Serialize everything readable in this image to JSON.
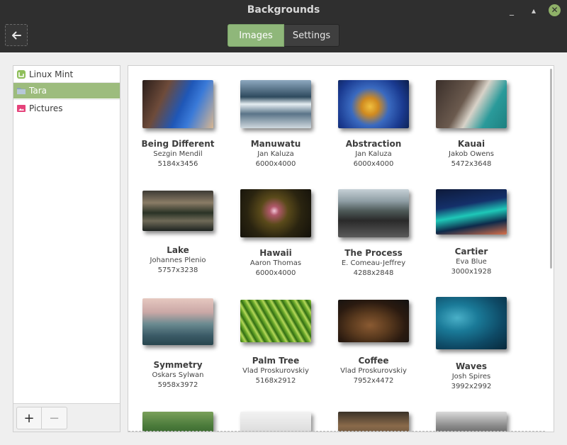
{
  "window": {
    "title": "Backgrounds"
  },
  "header": {
    "tabs": [
      {
        "label": "Images",
        "active": true
      },
      {
        "label": "Settings",
        "active": false
      }
    ]
  },
  "sidebar": {
    "items": [
      {
        "label": "Linux Mint",
        "selected": false,
        "icon": "mint-logo-icon"
      },
      {
        "label": "Tara",
        "selected": true,
        "icon": "folder-icon"
      },
      {
        "label": "Pictures",
        "selected": false,
        "icon": "pictures-folder-icon"
      }
    ],
    "add_label": "+",
    "remove_label": "−"
  },
  "gallery": {
    "items": [
      {
        "name": "Being Different",
        "author": "Sezgin Mendil",
        "size": "5184x3456"
      },
      {
        "name": "Manuwatu",
        "author": "Jan Kaluza",
        "size": "6000x4000"
      },
      {
        "name": "Abstraction",
        "author": "Jan Kaluza",
        "size": "6000x4000"
      },
      {
        "name": "Kauai",
        "author": "Jakob Owens",
        "size": "5472x3648"
      },
      {
        "name": "Lake",
        "author": "Johannes Plenio",
        "size": "5757x3238"
      },
      {
        "name": "Hawaii",
        "author": "Aaron Thomas",
        "size": "6000x4000"
      },
      {
        "name": "The Process",
        "author": "E. Comeau-Jeffrey",
        "size": "4288x2848"
      },
      {
        "name": "Cartier",
        "author": "Eva Blue",
        "size": "3000x1928"
      },
      {
        "name": "Symmetry",
        "author": "Oskars Sylwan",
        "size": "5958x3972"
      },
      {
        "name": "Palm Tree",
        "author": "Vlad Proskurovskiy",
        "size": "5168x2912"
      },
      {
        "name": "Coffee",
        "author": "Vlad Proskurovskiy",
        "size": "7952x4472"
      },
      {
        "name": "Waves",
        "author": "Josh Spires",
        "size": "3992x2992"
      }
    ]
  },
  "colors": {
    "accent": "#8fb77a",
    "header_bg": "#2f2f2f"
  }
}
